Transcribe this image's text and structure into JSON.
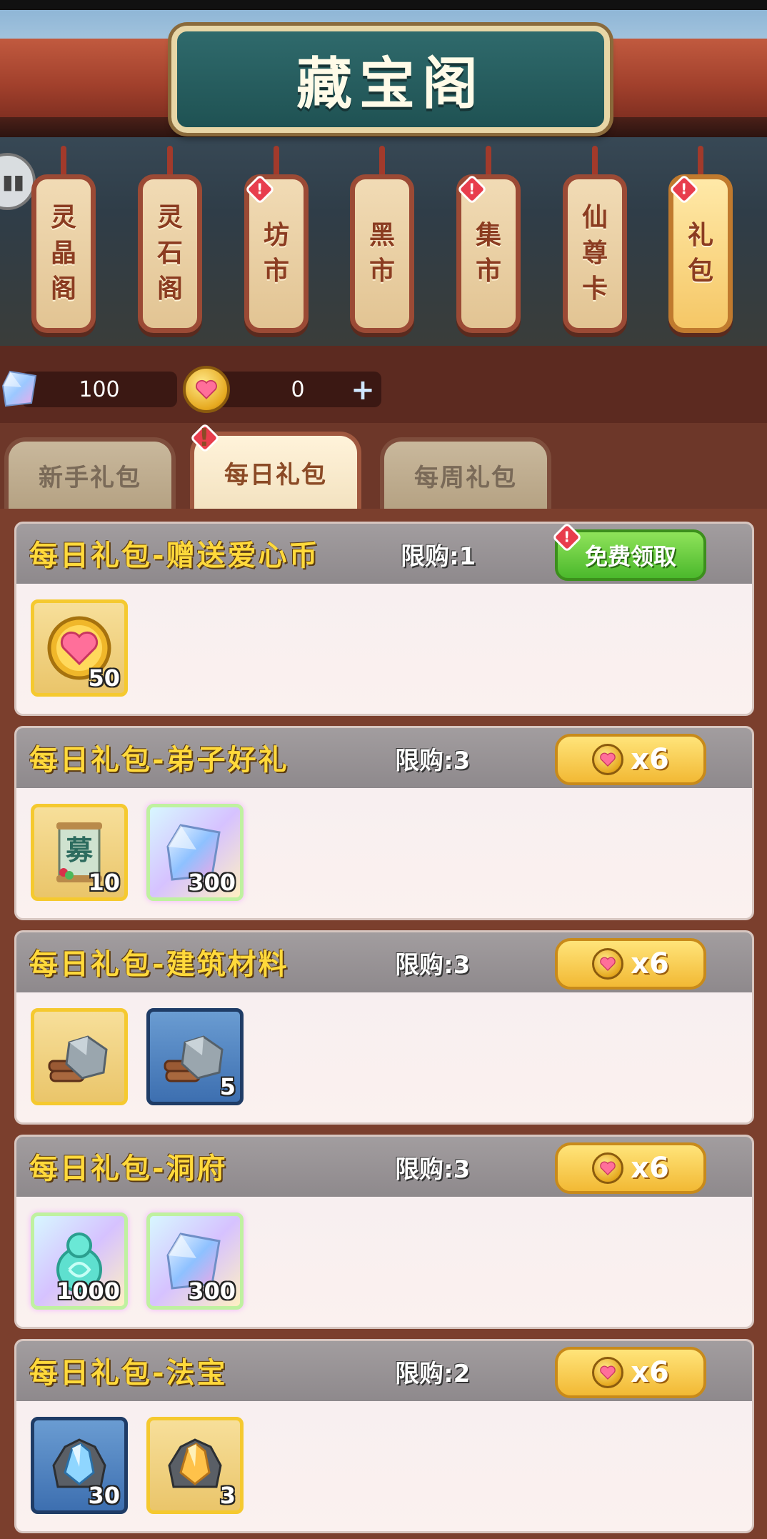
{
  "header": {
    "title": "藏宝阁"
  },
  "shop_tabs": [
    {
      "label": "灵晶阁",
      "alert": false,
      "active": false
    },
    {
      "label": "灵石阁",
      "alert": false,
      "active": false
    },
    {
      "label": "坊市",
      "alert": true,
      "active": false
    },
    {
      "label": "黑市",
      "alert": false,
      "active": false
    },
    {
      "label": "集市",
      "alert": true,
      "active": false
    },
    {
      "label": "仙尊卡",
      "alert": false,
      "active": false
    },
    {
      "label": "礼包",
      "alert": true,
      "active": true
    }
  ],
  "currency": {
    "crystal_amount": "100",
    "heart_coin_amount": "0",
    "add_symbol": "+"
  },
  "alert_symbol": "!",
  "category_tabs": [
    {
      "label": "新手礼包",
      "active": false,
      "alert": false
    },
    {
      "label": "每日礼包",
      "active": true,
      "alert": true
    },
    {
      "label": "每周礼包",
      "active": false,
      "alert": false
    }
  ],
  "packs": [
    {
      "title": "每日礼包-赠送爱心币",
      "limit": "限购:1",
      "button_type": "free",
      "button_label": "免费领取",
      "alert": true,
      "items": [
        {
          "icon": "heart-coin-icon",
          "frame": "gold",
          "qty": "50"
        }
      ]
    },
    {
      "title": "每日礼包-弟子好礼",
      "limit": "限购:3",
      "button_type": "price",
      "button_label": "x6",
      "alert": false,
      "items": [
        {
          "icon": "recruit-scroll-icon",
          "frame": "gold",
          "qty": "10"
        },
        {
          "icon": "crystal-icon",
          "frame": "rainbow",
          "qty": "300"
        }
      ]
    },
    {
      "title": "每日礼包-建筑材料",
      "limit": "限购:3",
      "button_type": "price",
      "button_label": "x6",
      "alert": false,
      "items": [
        {
          "icon": "stone-wood-icon",
          "frame": "gold",
          "qty": ""
        },
        {
          "icon": "stone-wood-icon",
          "frame": "blue",
          "qty": "5"
        }
      ]
    },
    {
      "title": "每日礼包-洞府",
      "limit": "限购:3",
      "button_type": "price",
      "button_label": "x6",
      "alert": false,
      "items": [
        {
          "icon": "jade-gourd-icon",
          "frame": "rainbow",
          "qty": "1000"
        },
        {
          "icon": "crystal-icon",
          "frame": "rainbow",
          "qty": "300"
        }
      ]
    },
    {
      "title": "每日礼包-法宝",
      "limit": "限购:2",
      "button_type": "price",
      "button_label": "x6",
      "alert": false,
      "items": [
        {
          "icon": "blue-ore-icon",
          "frame": "blue",
          "qty": "30"
        },
        {
          "icon": "gold-ore-icon",
          "frame": "gold",
          "qty": "3"
        }
      ]
    }
  ]
}
